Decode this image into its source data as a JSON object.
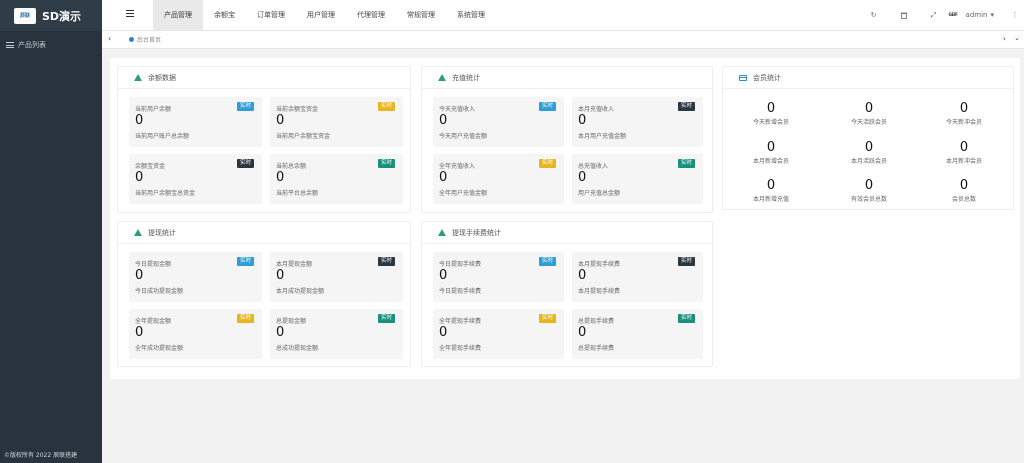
{
  "app": {
    "logo_mark": "辰联",
    "title": "SD演示",
    "copyright": "©版权所有 2022 辰联搭建"
  },
  "sidebar": {
    "items": [
      {
        "label": "产品列表"
      }
    ]
  },
  "header": {
    "nav": [
      {
        "label": "产品管理",
        "active": true
      },
      {
        "label": "余额宝"
      },
      {
        "label": "订单管理"
      },
      {
        "label": "用户管理"
      },
      {
        "label": "代理管理"
      },
      {
        "label": "常规管理"
      },
      {
        "label": "系统管理"
      }
    ],
    "refresh_icon": "↻",
    "trash_icon": "🗑",
    "fullscreen_icon": "⤢",
    "avatar_text": "GEIF",
    "user": "admin",
    "more_icon": "⋮"
  },
  "tabs": {
    "home": "后台首页"
  },
  "panels": {
    "balance": {
      "title": "余额数据",
      "stats": [
        {
          "title": "当前用户余额",
          "value": "0",
          "sub": "当前用户账户总余额",
          "badge": "实时",
          "badge_color": "#2f9ed8"
        },
        {
          "title": "当前余额宝资金",
          "value": "0",
          "sub": "当前用户余额宝资金",
          "badge": "实时",
          "badge_color": "#e8b51f"
        },
        {
          "title": "余额宝资金",
          "value": "0",
          "sub": "当前用户余额宝总资金",
          "badge": "实时",
          "badge_color": "#2b3640"
        },
        {
          "title": "当前总余额",
          "value": "0",
          "sub": "当前平台总余额",
          "badge": "实时",
          "badge_color": "#1a8f7a"
        }
      ]
    },
    "recharge": {
      "title": "充值统计",
      "stats": [
        {
          "title": "今天充值收入",
          "value": "0",
          "sub": "今天用户充值金额",
          "badge": "实时",
          "badge_color": "#2f9ed8"
        },
        {
          "title": "本月充值收入",
          "value": "0",
          "sub": "本月用户充值金额",
          "badge": "实时",
          "badge_color": "#2b3640"
        },
        {
          "title": "全年充值收入",
          "value": "0",
          "sub": "全年用户充值金额",
          "badge": "实时",
          "badge_color": "#e8b51f"
        },
        {
          "title": "总充值收入",
          "value": "0",
          "sub": "用户充值总金额",
          "badge": "实时",
          "badge_color": "#1a8f7a"
        }
      ]
    },
    "members": {
      "title": "会员统计",
      "stats": [
        {
          "value": "0",
          "label": "今天新增会员"
        },
        {
          "value": "0",
          "label": "今天活跃会员"
        },
        {
          "value": "0",
          "label": "今天新冲会员"
        },
        {
          "value": "0",
          "label": "本月新增会员"
        },
        {
          "value": "0",
          "label": "本月活跃会员"
        },
        {
          "value": "0",
          "label": "本月新冲会员"
        },
        {
          "value": "0",
          "label": "本月新增充值"
        },
        {
          "value": "0",
          "label": "有效会员总数"
        },
        {
          "value": "0",
          "label": "会员总数"
        }
      ]
    },
    "withdraw": {
      "title": "提现统计",
      "stats": [
        {
          "title": "今日提现金额",
          "value": "0",
          "sub": "今日成功提现金额",
          "badge": "实时",
          "badge_color": "#2f9ed8"
        },
        {
          "title": "本月提现金额",
          "value": "0",
          "sub": "本月成功提现金额",
          "badge": "实时",
          "badge_color": "#2b3640"
        },
        {
          "title": "全年提现金额",
          "value": "0",
          "sub": "全年成功提现金额",
          "badge": "实时",
          "badge_color": "#e8b51f"
        },
        {
          "title": "总提现金额",
          "value": "0",
          "sub": "总成功提现金额",
          "badge": "实时",
          "badge_color": "#1a8f7a"
        }
      ]
    },
    "fee": {
      "title": "提现手续费统计",
      "stats": [
        {
          "title": "今日提现手续费",
          "value": "0",
          "sub": "今日提现手续费",
          "badge": "实时",
          "badge_color": "#2f9ed8"
        },
        {
          "title": "本月提现手续费",
          "value": "0",
          "sub": "本月提现手续费",
          "badge": "实时",
          "badge_color": "#2b3640"
        },
        {
          "title": "全年提现手续费",
          "value": "0",
          "sub": "全年提现手续费",
          "badge": "实时",
          "badge_color": "#e8b51f"
        },
        {
          "title": "总提现手续费",
          "value": "0",
          "sub": "总提现手续费",
          "badge": "实时",
          "badge_color": "#1a8f7a"
        }
      ]
    }
  }
}
